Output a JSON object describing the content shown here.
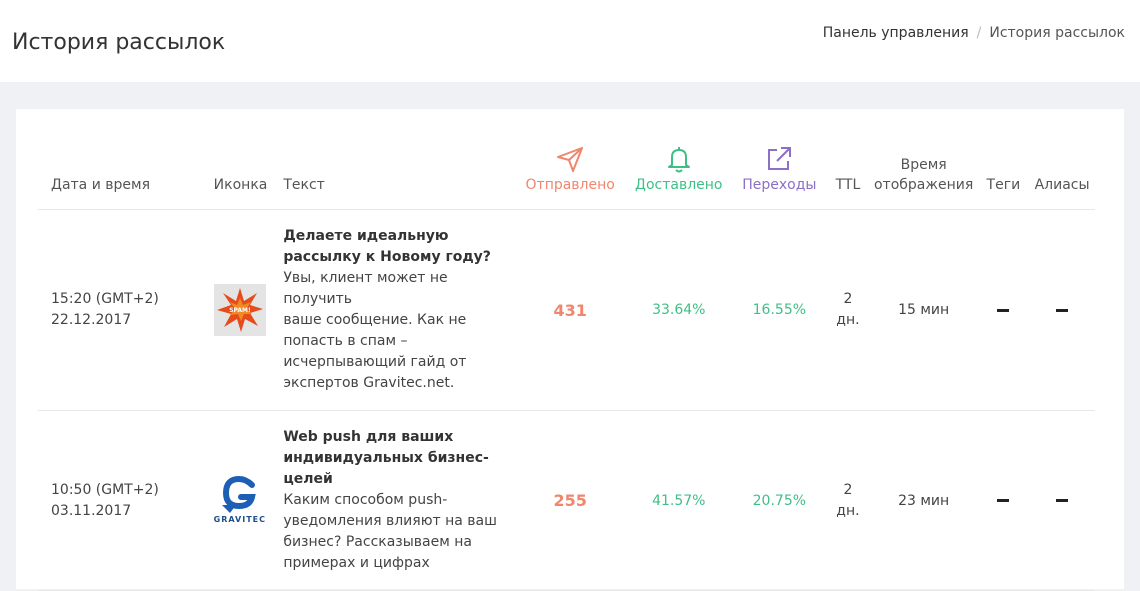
{
  "header": {
    "title": "История рассылок",
    "breadcrumb": {
      "home": "Панель управления",
      "separator": "/",
      "current": "История рассылок"
    }
  },
  "table": {
    "columns": {
      "date": "Дата и время",
      "icon": "Иконка",
      "text": "Текст",
      "sent": "Отправлено",
      "delivered": "Доставлено",
      "clicks": "Переходы",
      "ttl": "TTL",
      "display_time_1": "Время",
      "display_time_2": "отображения",
      "tags": "Теги",
      "aliases": "Алиасы"
    },
    "column_icons": {
      "sent": "paper-plane-icon",
      "delivered": "bell-icon",
      "clicks": "external-link-icon"
    },
    "colors": {
      "sent": "#f0866c",
      "delivered": "#3fbf86",
      "clicks": "#8b6fc8"
    },
    "rows": [
      {
        "time": "15:20 (GMT+2)",
        "date": "22.12.2017",
        "icon_name": "spam-thumbnail",
        "icon_text": "SPAM!",
        "title_lines": [
          "Делаете идеальную",
          "рассылку к Новому году?"
        ],
        "body_lines": [
          "Увы, клиент может не получить",
          "ваше сообщение. Как не",
          "попасть в спам –",
          "исчерпывающий гайд от",
          "экспертов Gravitec.net."
        ],
        "sent": "431",
        "delivered": "33.64%",
        "clicks": "16.55%",
        "ttl_1": "2",
        "ttl_2": "дн.",
        "display_time": "15 мин"
      },
      {
        "time": "10:50 (GMT+2)",
        "date": "03.11.2017",
        "icon_name": "gravitec-logo",
        "icon_text": "GRAVITEC",
        "title_lines": [
          "Web push для ваших",
          "индивидуальных бизнес-",
          "целей"
        ],
        "body_lines": [
          "Каким способом push-",
          "уведомления влияют на ваш",
          "бизнес? Рассказываем на",
          "примерах и цифрах"
        ],
        "sent": "255",
        "delivered": "41.57%",
        "clicks": "20.75%",
        "ttl_1": "2",
        "ttl_2": "дн.",
        "display_time": "23 мин"
      }
    ]
  }
}
